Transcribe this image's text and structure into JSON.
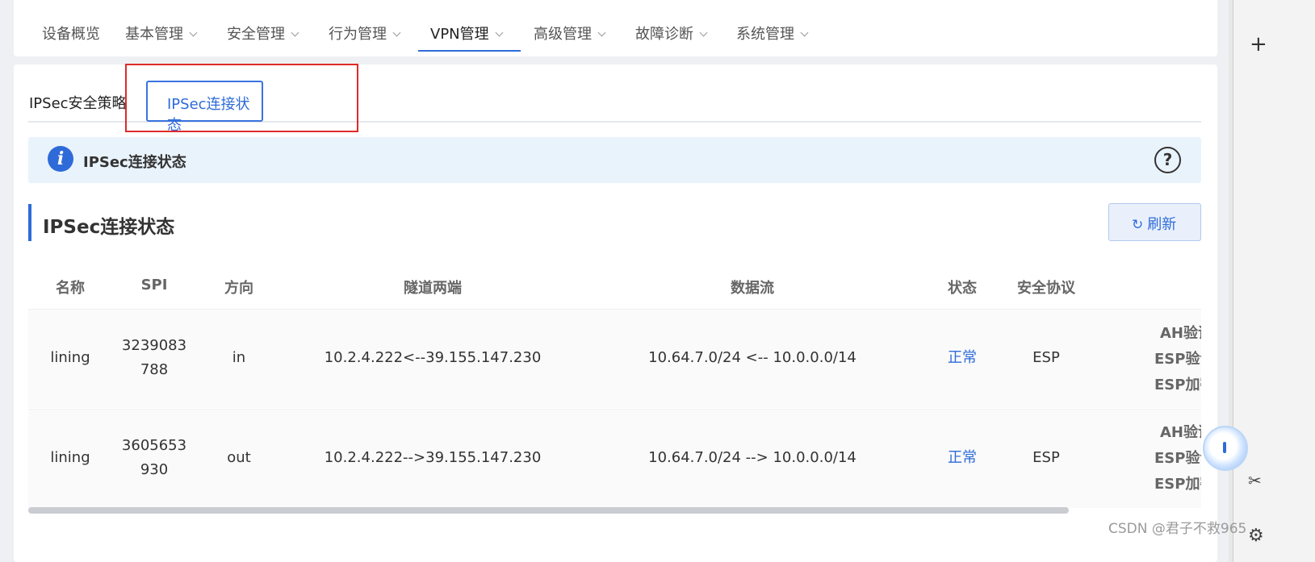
{
  "nav": {
    "items": [
      {
        "label": "设备概览",
        "dropdown": false
      },
      {
        "label": "基本管理",
        "dropdown": true
      },
      {
        "label": "安全管理",
        "dropdown": true
      },
      {
        "label": "行为管理",
        "dropdown": true
      },
      {
        "label": "VPN管理",
        "dropdown": true,
        "active": true
      },
      {
        "label": "高级管理",
        "dropdown": true
      },
      {
        "label": "故障诊断",
        "dropdown": true
      },
      {
        "label": "系统管理",
        "dropdown": true
      }
    ]
  },
  "tabs": {
    "policy": "IPSec安全策略",
    "status": "IPSec连接状态"
  },
  "info": {
    "icon": "i",
    "title": "IPSec连接状态",
    "help": "?"
  },
  "section": {
    "title": "IPSec连接状态",
    "refresh_icon": "↻",
    "refresh_label": "刷新"
  },
  "table": {
    "headers": {
      "name": "名称",
      "spi": "SPI",
      "direction": "方向",
      "tunnel": "隧道两端",
      "flow": "数据流",
      "status": "状态",
      "protocol": "安全协议"
    },
    "rows": [
      {
        "name": "lining",
        "spi_a": "3239083",
        "spi_b": "788",
        "direction": "in",
        "tunnel": "10.2.4.222<--39.155.147.230",
        "flow": "10.64.7.0/24 <-- 10.0.0.0/14",
        "status": "正常",
        "protocol": "ESP",
        "algo": [
          "AH验证",
          "ESP验证",
          "ESP加密"
        ]
      },
      {
        "name": "lining",
        "spi_a": "3605653",
        "spi_b": "930",
        "direction": "out",
        "tunnel": "10.2.4.222-->39.155.147.230",
        "flow": "10.64.7.0/24 --> 10.0.0.0/14",
        "status": "正常",
        "protocol": "ESP",
        "algo": [
          "AH验证",
          "ESP验证",
          "ESP加密"
        ]
      }
    ]
  },
  "side": {
    "plus": "+",
    "scissor": "✂",
    "gear": "⚙"
  },
  "watermark": "CSDN @君子不救965",
  "colors": {
    "accent": "#2f6bd8",
    "highlight_box": "#e02a2a",
    "info_bg": "#e9f3fc"
  }
}
